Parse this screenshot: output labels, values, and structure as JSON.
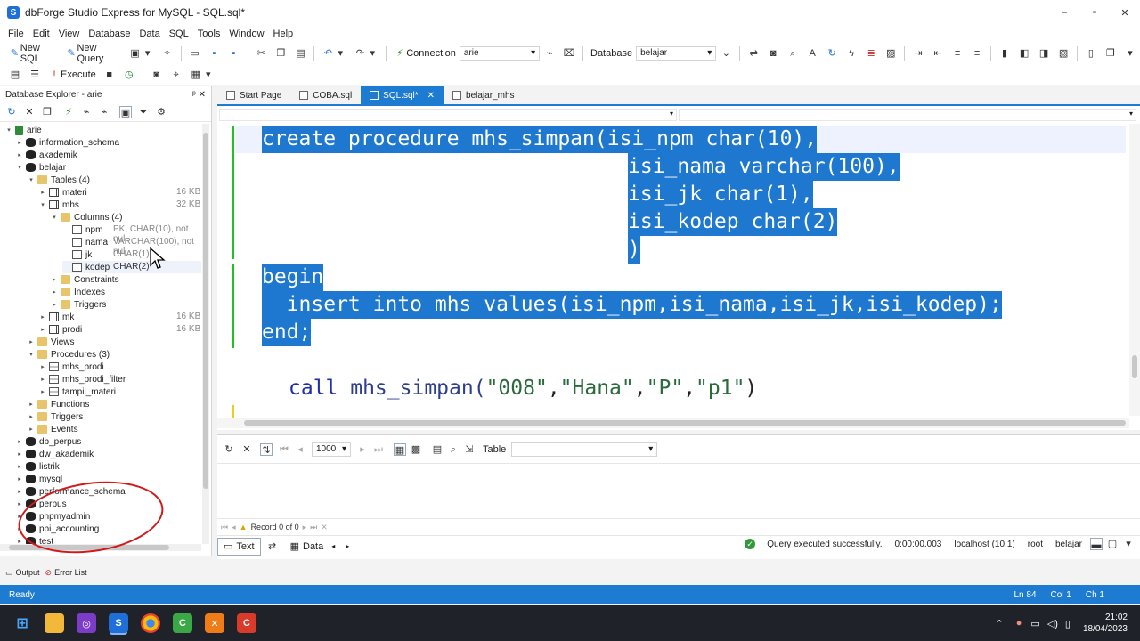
{
  "window": {
    "title": "dbForge Studio Express for MySQL - SQL.sql*",
    "minimize": "–",
    "maximize": "▫",
    "close": "✕"
  },
  "menu": [
    "File",
    "Edit",
    "View",
    "Database",
    "Data",
    "SQL",
    "Tools",
    "Window",
    "Help"
  ],
  "toolbar": {
    "new_sql": "New SQL",
    "new_query": "New Query",
    "execute": "Execute",
    "connection_label": "Connection",
    "connection_value": "arie",
    "database_label": "Database",
    "database_value": "belajar"
  },
  "explorer": {
    "title": "Database Explorer - arie",
    "pin": "ᵖ",
    "close": "✕",
    "rows": [
      {
        "label": "arie",
        "meta": ""
      },
      {
        "label": "information_schema",
        "meta": ""
      },
      {
        "label": "akademik",
        "meta": ""
      },
      {
        "label": "belajar",
        "meta": ""
      },
      {
        "label": "Tables (4)",
        "meta": ""
      },
      {
        "label": "materi",
        "meta": "16 KB"
      },
      {
        "label": "mhs",
        "meta": "32 KB"
      },
      {
        "label": "Columns (4)",
        "meta": ""
      },
      {
        "label": "npm",
        "meta": "PK, CHAR(10), not null,"
      },
      {
        "label": "nama",
        "meta": "VARCHAR(100), not nul"
      },
      {
        "label": "jk",
        "meta": "CHAR(1)"
      },
      {
        "label": "kodep",
        "meta": "CHAR(2)"
      },
      {
        "label": "Constraints",
        "meta": ""
      },
      {
        "label": "Indexes",
        "meta": ""
      },
      {
        "label": "Triggers",
        "meta": ""
      },
      {
        "label": "mk",
        "meta": "16 KB"
      },
      {
        "label": "prodi",
        "meta": "16 KB"
      },
      {
        "label": "Views",
        "meta": ""
      },
      {
        "label": "Procedures (3)",
        "meta": ""
      },
      {
        "label": "mhs_prodi",
        "meta": ""
      },
      {
        "label": "mhs_prodi_filter",
        "meta": ""
      },
      {
        "label": "tampil_materi",
        "meta": ""
      },
      {
        "label": "Functions",
        "meta": ""
      },
      {
        "label": "Triggers",
        "meta": ""
      },
      {
        "label": "Events",
        "meta": ""
      },
      {
        "label": "db_perpus",
        "meta": ""
      },
      {
        "label": "dw_akademik",
        "meta": ""
      },
      {
        "label": "listrik",
        "meta": ""
      },
      {
        "label": "mysql",
        "meta": ""
      },
      {
        "label": "performance_schema",
        "meta": ""
      },
      {
        "label": "perpus",
        "meta": ""
      },
      {
        "label": "phpmyadmin",
        "meta": ""
      },
      {
        "label": "ppi_accounting",
        "meta": ""
      },
      {
        "label": "test",
        "meta": ""
      }
    ]
  },
  "tabs": [
    {
      "label": "Start Page"
    },
    {
      "label": "COBA.sql"
    },
    {
      "label": "SQL.sql*",
      "close": "✕"
    },
    {
      "label": "belajar_mhs"
    }
  ],
  "editor": {
    "lines": {
      "l1": "create procedure mhs_simpan(isi_npm char(10),",
      "l2": "isi_nama varchar(100),",
      "l3": "isi_jk char(1),",
      "l4": "isi_kodep char(2)",
      "l5": ")",
      "l6": "begin",
      "l7": "  insert into mhs values(isi_npm,isi_nama,isi_jk,isi_kodep);",
      "l8": "end;"
    },
    "call": {
      "kw": "call",
      "fn": " mhs_simpan(",
      "a1": "\"008\"",
      "c1": ",",
      "a2": "\"Hana\"",
      "c2": ",",
      "a3": "\"P\"",
      "c3": ",",
      "a4": "\"p1\"",
      "end": ")"
    }
  },
  "results": {
    "page_size": "1000",
    "table_label": "Table",
    "record": "Record 0 of 0",
    "text_tab": "Text",
    "data_tab": "Data",
    "status": "Query executed successfully.",
    "duration": "0:00:00.003",
    "host": "localhost (10.1)",
    "user": "root",
    "db": "belajar"
  },
  "bottom_tabs": [
    "Output",
    "Error List"
  ],
  "statusbar": {
    "ready": "Ready",
    "ln": "Ln 84",
    "col": "Col 1",
    "ch": "Ch 1"
  },
  "taskbar": {
    "time": "21:02",
    "date": "18/04/2023"
  },
  "colors": {
    "accent": "#1e7bd2",
    "selection": "#1e78cf",
    "annotation": "#d21818"
  }
}
